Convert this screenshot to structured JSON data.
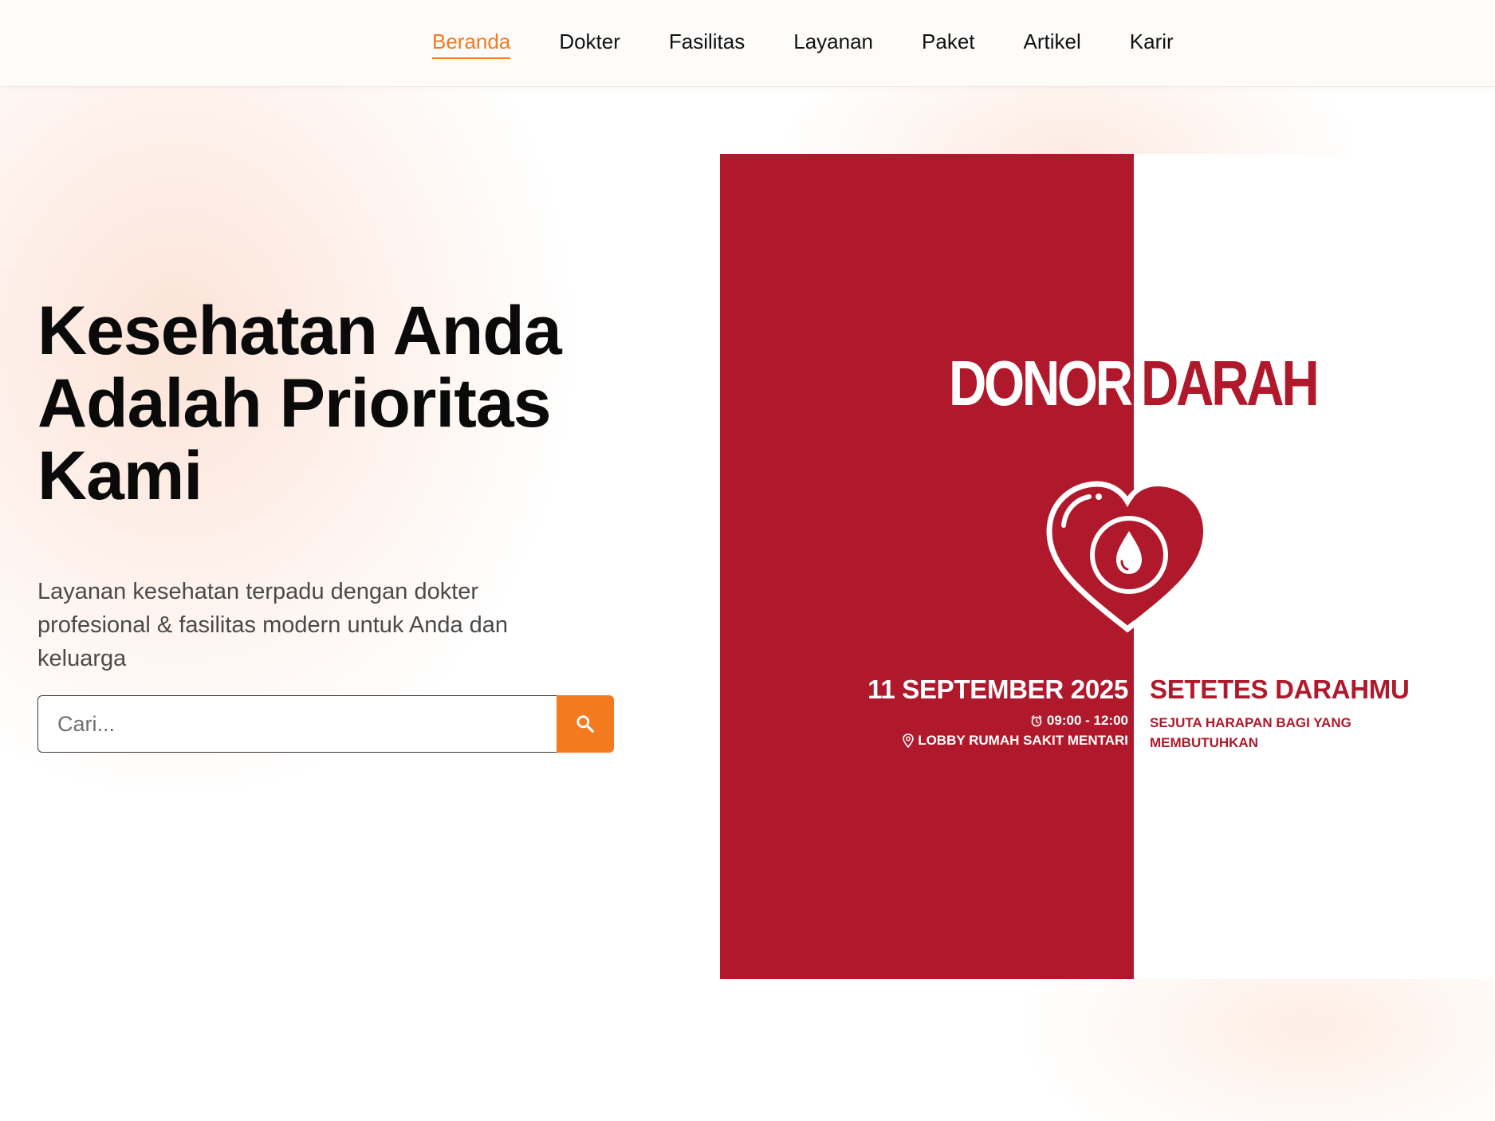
{
  "nav": {
    "items": [
      {
        "label": "Beranda",
        "active": true
      },
      {
        "label": "Dokter"
      },
      {
        "label": "Fasilitas"
      },
      {
        "label": "Layanan"
      },
      {
        "label": "Paket"
      },
      {
        "label": "Artikel"
      },
      {
        "label": "Karir"
      }
    ]
  },
  "hero": {
    "title": "Kesehatan Anda Adalah Prioritas Kami",
    "subtitle": "Layanan kesehatan terpadu dengan dokter profesional & fasilitas modern untuk Anda dan keluarga",
    "search": {
      "placeholder": "Cari...",
      "button_icon": "search-icon"
    }
  },
  "banner": {
    "headline_left": "DONOR",
    "headline_right": "DARAH",
    "emblem_icon": "heart-blood-drop-icon",
    "date": "11 SEPTEMBER 2025",
    "time": "09:00 - 12:00",
    "time_icon": "alarm-clock-icon",
    "location": "LOBBY RUMAH SAKIT MENTARI",
    "location_icon": "map-pin-icon",
    "tagline": "SETETES DARAHMU",
    "tagline_sub": "SEJUTA HARAPAN BAGI YANG MEMBUTUHKAN"
  },
  "colors": {
    "accent": "#f47a20",
    "banner_red": "#b0192b",
    "text_dark": "#0a0a0a",
    "text_muted": "#4a4a4a"
  }
}
